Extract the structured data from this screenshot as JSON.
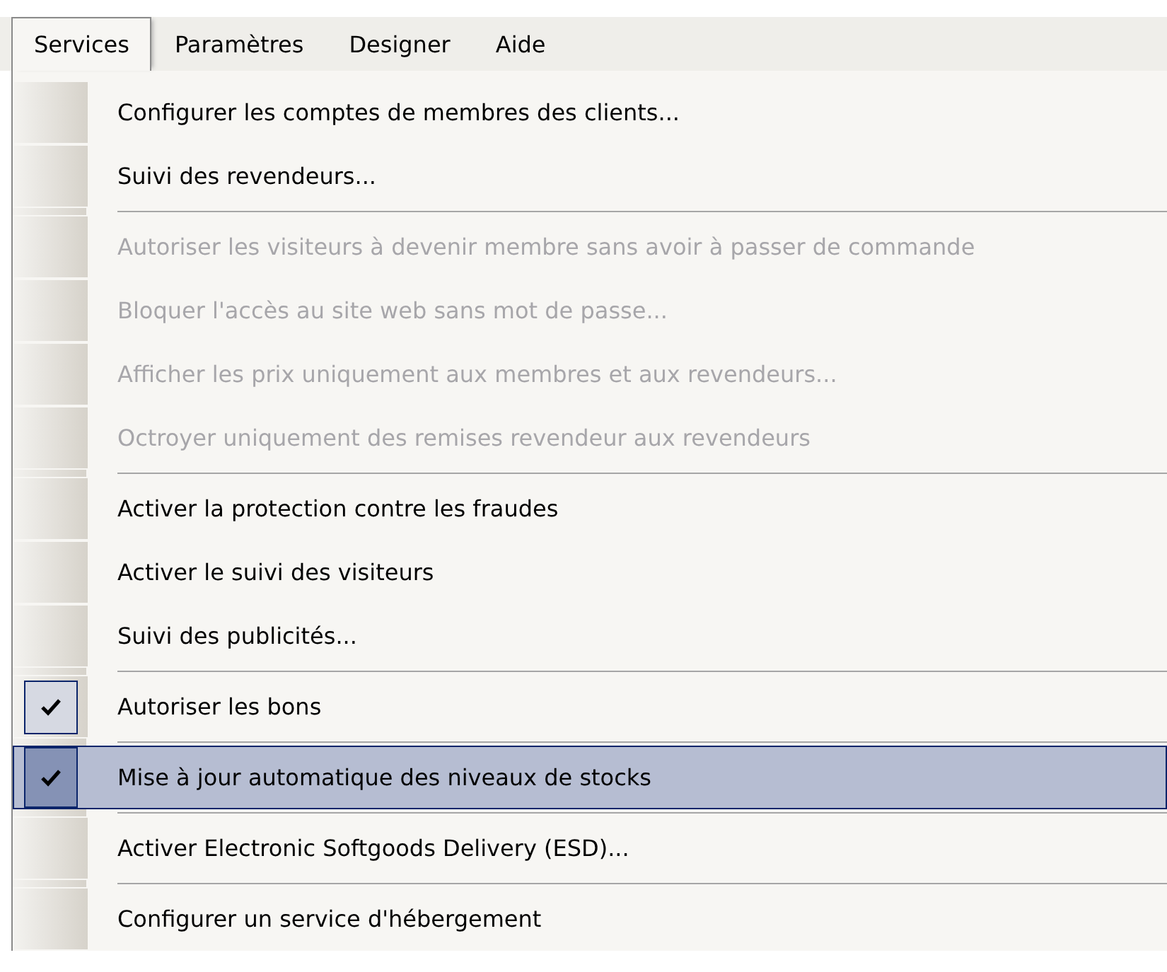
{
  "menu_bar": [
    {
      "label": "Services",
      "selected": true
    },
    {
      "label": "Paramètres",
      "selected": false
    },
    {
      "label": "Designer",
      "selected": false
    },
    {
      "label": "Aide",
      "selected": false
    }
  ],
  "menu": {
    "items": [
      {
        "kind": "item",
        "label": "Configurer les comptes de membres des clients...",
        "disabled": false,
        "checked": false,
        "selected": false
      },
      {
        "kind": "item",
        "label": "Suivi des revendeurs...",
        "disabled": false,
        "checked": false,
        "selected": false
      },
      {
        "kind": "separator"
      },
      {
        "kind": "item",
        "label": "Autoriser les visiteurs à devenir membre sans avoir à passer de commande",
        "disabled": true,
        "checked": false,
        "selected": false
      },
      {
        "kind": "item",
        "label": "Bloquer l'accès au site web sans mot de passe...",
        "disabled": true,
        "checked": false,
        "selected": false
      },
      {
        "kind": "item",
        "label": "Afficher les prix uniquement aux membres et aux revendeurs...",
        "disabled": true,
        "checked": false,
        "selected": false
      },
      {
        "kind": "item",
        "label": "Octroyer uniquement des remises revendeur aux revendeurs",
        "disabled": true,
        "checked": false,
        "selected": false
      },
      {
        "kind": "separator"
      },
      {
        "kind": "item",
        "label": "Activer la protection contre les fraudes",
        "disabled": false,
        "checked": false,
        "selected": false
      },
      {
        "kind": "item",
        "label": "Activer le suivi des visiteurs",
        "disabled": false,
        "checked": false,
        "selected": false
      },
      {
        "kind": "item",
        "label": "Suivi des publicités...",
        "disabled": false,
        "checked": false,
        "selected": false
      },
      {
        "kind": "separator"
      },
      {
        "kind": "item",
        "label": "Autoriser les bons",
        "disabled": false,
        "checked": true,
        "selected": false
      },
      {
        "kind": "separator"
      },
      {
        "kind": "item",
        "label": "Mise à jour automatique des niveaux de stocks",
        "disabled": false,
        "checked": true,
        "selected": true
      },
      {
        "kind": "separator"
      },
      {
        "kind": "item",
        "label": "Activer Electronic Softgoods Delivery (ESD)...",
        "disabled": false,
        "checked": false,
        "selected": false
      },
      {
        "kind": "separator"
      },
      {
        "kind": "item",
        "label": "Configurer un service d'hébergement",
        "disabled": false,
        "checked": false,
        "selected": false
      }
    ]
  }
}
